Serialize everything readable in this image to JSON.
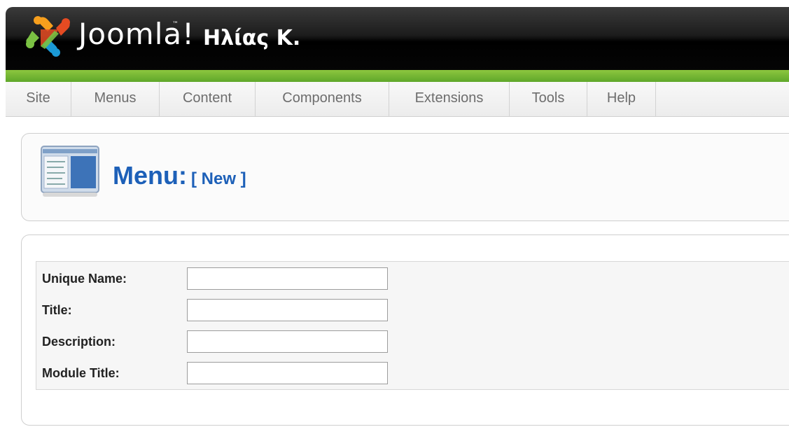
{
  "header": {
    "logo_text": "Joomla!",
    "logo_tm": "™",
    "site_name": "Ηλίας Κ."
  },
  "menubar": {
    "items": [
      {
        "label": "Site"
      },
      {
        "label": "Menus"
      },
      {
        "label": "Content"
      },
      {
        "label": "Components"
      },
      {
        "label": "Extensions"
      },
      {
        "label": "Tools"
      },
      {
        "label": "Help"
      }
    ]
  },
  "toolbar": {
    "title": "Menu:",
    "subtitle": "[ New ]",
    "icon": "menu-manager-icon"
  },
  "form": {
    "fields": [
      {
        "label": "Unique Name:",
        "value": ""
      },
      {
        "label": "Title:",
        "value": ""
      },
      {
        "label": "Description:",
        "value": ""
      },
      {
        "label": "Module Title:",
        "value": ""
      }
    ]
  },
  "colors": {
    "header_bg": "#000000",
    "accent_green": "#6db33f",
    "title_blue": "#1d60b8",
    "menu_text": "#6d6d6d"
  }
}
